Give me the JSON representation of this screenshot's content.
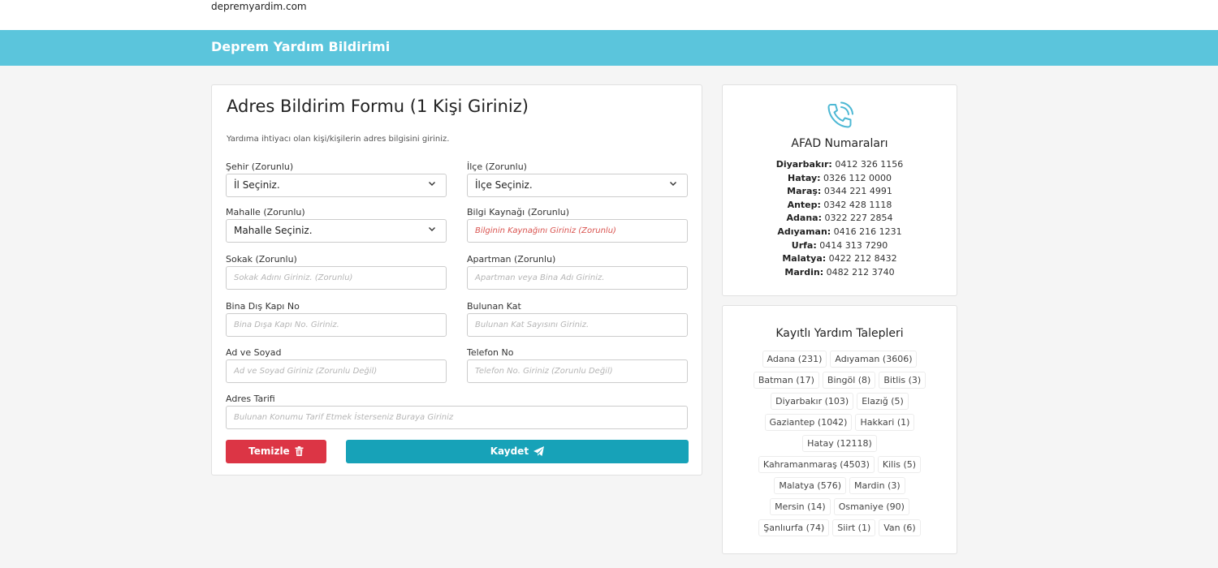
{
  "site": {
    "name": "depremyardim.com"
  },
  "header": {
    "title": "Deprem Yardım Bildirimi"
  },
  "form": {
    "title": "Adres Bildirim Formu (1 Kişi Giriniz)",
    "description": "Yardıma ihtiyacı olan kişi/kişilerin adres bilgisini giriniz.",
    "fields": {
      "sehir": {
        "label": "Şehir (Zorunlu)",
        "value": "İl Seçiniz."
      },
      "ilce": {
        "label": "İlçe (Zorunlu)",
        "value": "İlçe Seçiniz."
      },
      "mahalle": {
        "label": "Mahalle (Zorunlu)",
        "value": "Mahalle Seçiniz."
      },
      "bilgi": {
        "label": "Bilgi Kaynağı (Zorunlu)",
        "placeholder": "Bilginin Kaynağını Giriniz (Zorunlu)"
      },
      "sokak": {
        "label": "Sokak (Zorunlu)",
        "placeholder": "Sokak Adını Giriniz. (Zorunlu)"
      },
      "apartman": {
        "label": "Apartman (Zorunlu)",
        "placeholder": "Apartman veya Bina Adı Giriniz."
      },
      "kapi": {
        "label": "Bina Dış Kapı No",
        "placeholder": "Bina Dışa Kapı No. Giriniz."
      },
      "kat": {
        "label": "Bulunan Kat",
        "placeholder": "Bulunan Kat Sayısını Giriniz."
      },
      "adsoyad": {
        "label": "Ad ve Soyad",
        "placeholder": "Ad ve Soyad Giriniz (Zorunlu Değil)"
      },
      "telefon": {
        "label": "Telefon No",
        "placeholder": "Telefon No. Giriniz (Zorunlu Değil)"
      },
      "tarif": {
        "label": "Adres Tarifi",
        "placeholder": "Bulunan Konumu Tarif Etmek İsterseniz Buraya Giriniz"
      }
    },
    "buttons": {
      "clear": "Temizle",
      "save": "Kaydet"
    }
  },
  "afad": {
    "title": "AFAD Numaraları",
    "numbers": [
      {
        "city": "Diyarbakır:",
        "phone": "0412 326 1156"
      },
      {
        "city": "Hatay:",
        "phone": "0326 112 0000"
      },
      {
        "city": "Maraş:",
        "phone": "0344 221 4991"
      },
      {
        "city": "Antep:",
        "phone": "0342 428 1118"
      },
      {
        "city": "Adana:",
        "phone": "0322 227 2854"
      },
      {
        "city": "Adıyaman:",
        "phone": "0416 216 1231"
      },
      {
        "city": "Urfa:",
        "phone": "0414 313 7290"
      },
      {
        "city": "Malatya:",
        "phone": "0422 212 8432"
      },
      {
        "city": "Mardin:",
        "phone": "0482 212 3740"
      }
    ]
  },
  "talepler": {
    "title": "Kayıtlı Yardım Talepleri",
    "items": [
      "Adana (231)",
      "Adıyaman (3606)",
      "Batman (17)",
      "Bingöl (8)",
      "Bitlis (3)",
      "Diyarbakır (103)",
      "Elazığ (5)",
      "Gaziantep (1042)",
      "Hakkari (1)",
      "Hatay (12118)",
      "Kahramanmaraş (4503)",
      "Kilis (5)",
      "Malatya (576)",
      "Mardin (3)",
      "Mersin (14)",
      "Osmaniye (90)",
      "Şanlıurfa (74)",
      "Siirt (1)",
      "Van (6)"
    ]
  }
}
